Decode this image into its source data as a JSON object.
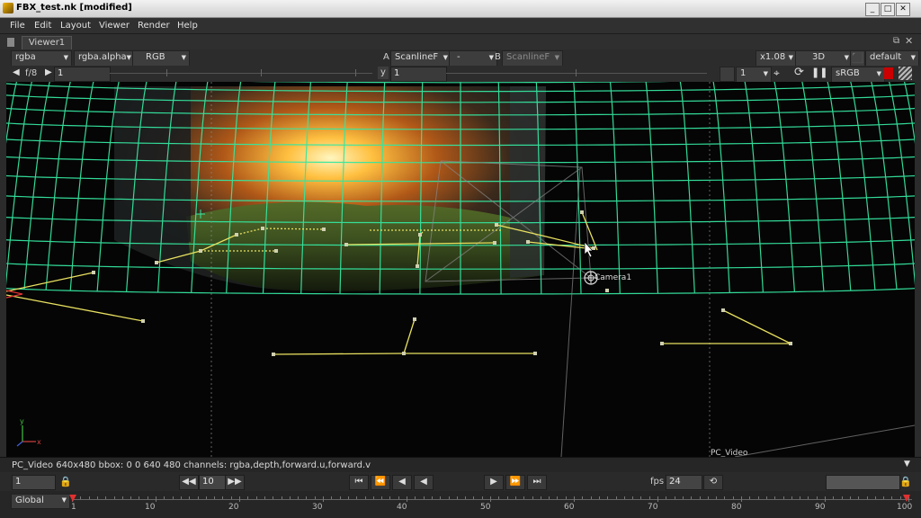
{
  "window": {
    "title": "FBX_test.nk [modified]",
    "buttons": [
      "_",
      "□",
      "✕"
    ]
  },
  "menu": {
    "items": [
      "File",
      "Edit",
      "Layout",
      "Viewer",
      "Render",
      "Help"
    ]
  },
  "tabs": {
    "viewer_tab": "Viewer1"
  },
  "toolbar1": {
    "channels": "rgba",
    "alpha_channel": "rgba.alpha",
    "display_channels": "RGB",
    "a_label": "A",
    "a_input": "ScanlineF",
    "compare_mode": "-",
    "b_label": "B",
    "b_input": "ScanlineF",
    "zoom": "x1.08",
    "view_mode": "3D",
    "camera": "default"
  },
  "toolbar2": {
    "proxy": "f/8",
    "frame_gain": "1",
    "y_label": "y",
    "gamma": "1",
    "roi_frame": "1",
    "colorspace": "sRGB"
  },
  "viewport": {
    "camera_label": "Camera1",
    "format_label": "PC_Video",
    "axis_x": "x",
    "axis_y": "y"
  },
  "infobar": {
    "text": "PC_Video 640x480 bbox: 0 0 640 480 channels: rgba,depth,forward.u,forward.v"
  },
  "playback": {
    "current_frame": "1",
    "step": "10",
    "fps_label": "fps",
    "fps": "24",
    "range_mode": "Global"
  },
  "timeline": {
    "ticks": [
      "1",
      "10",
      "20",
      "30",
      "40",
      "50",
      "60",
      "70",
      "80",
      "90",
      "100"
    ]
  },
  "colors": {
    "grid": "#35e6a0",
    "wire": "#e8e060",
    "viewport_bg": "#050505"
  }
}
